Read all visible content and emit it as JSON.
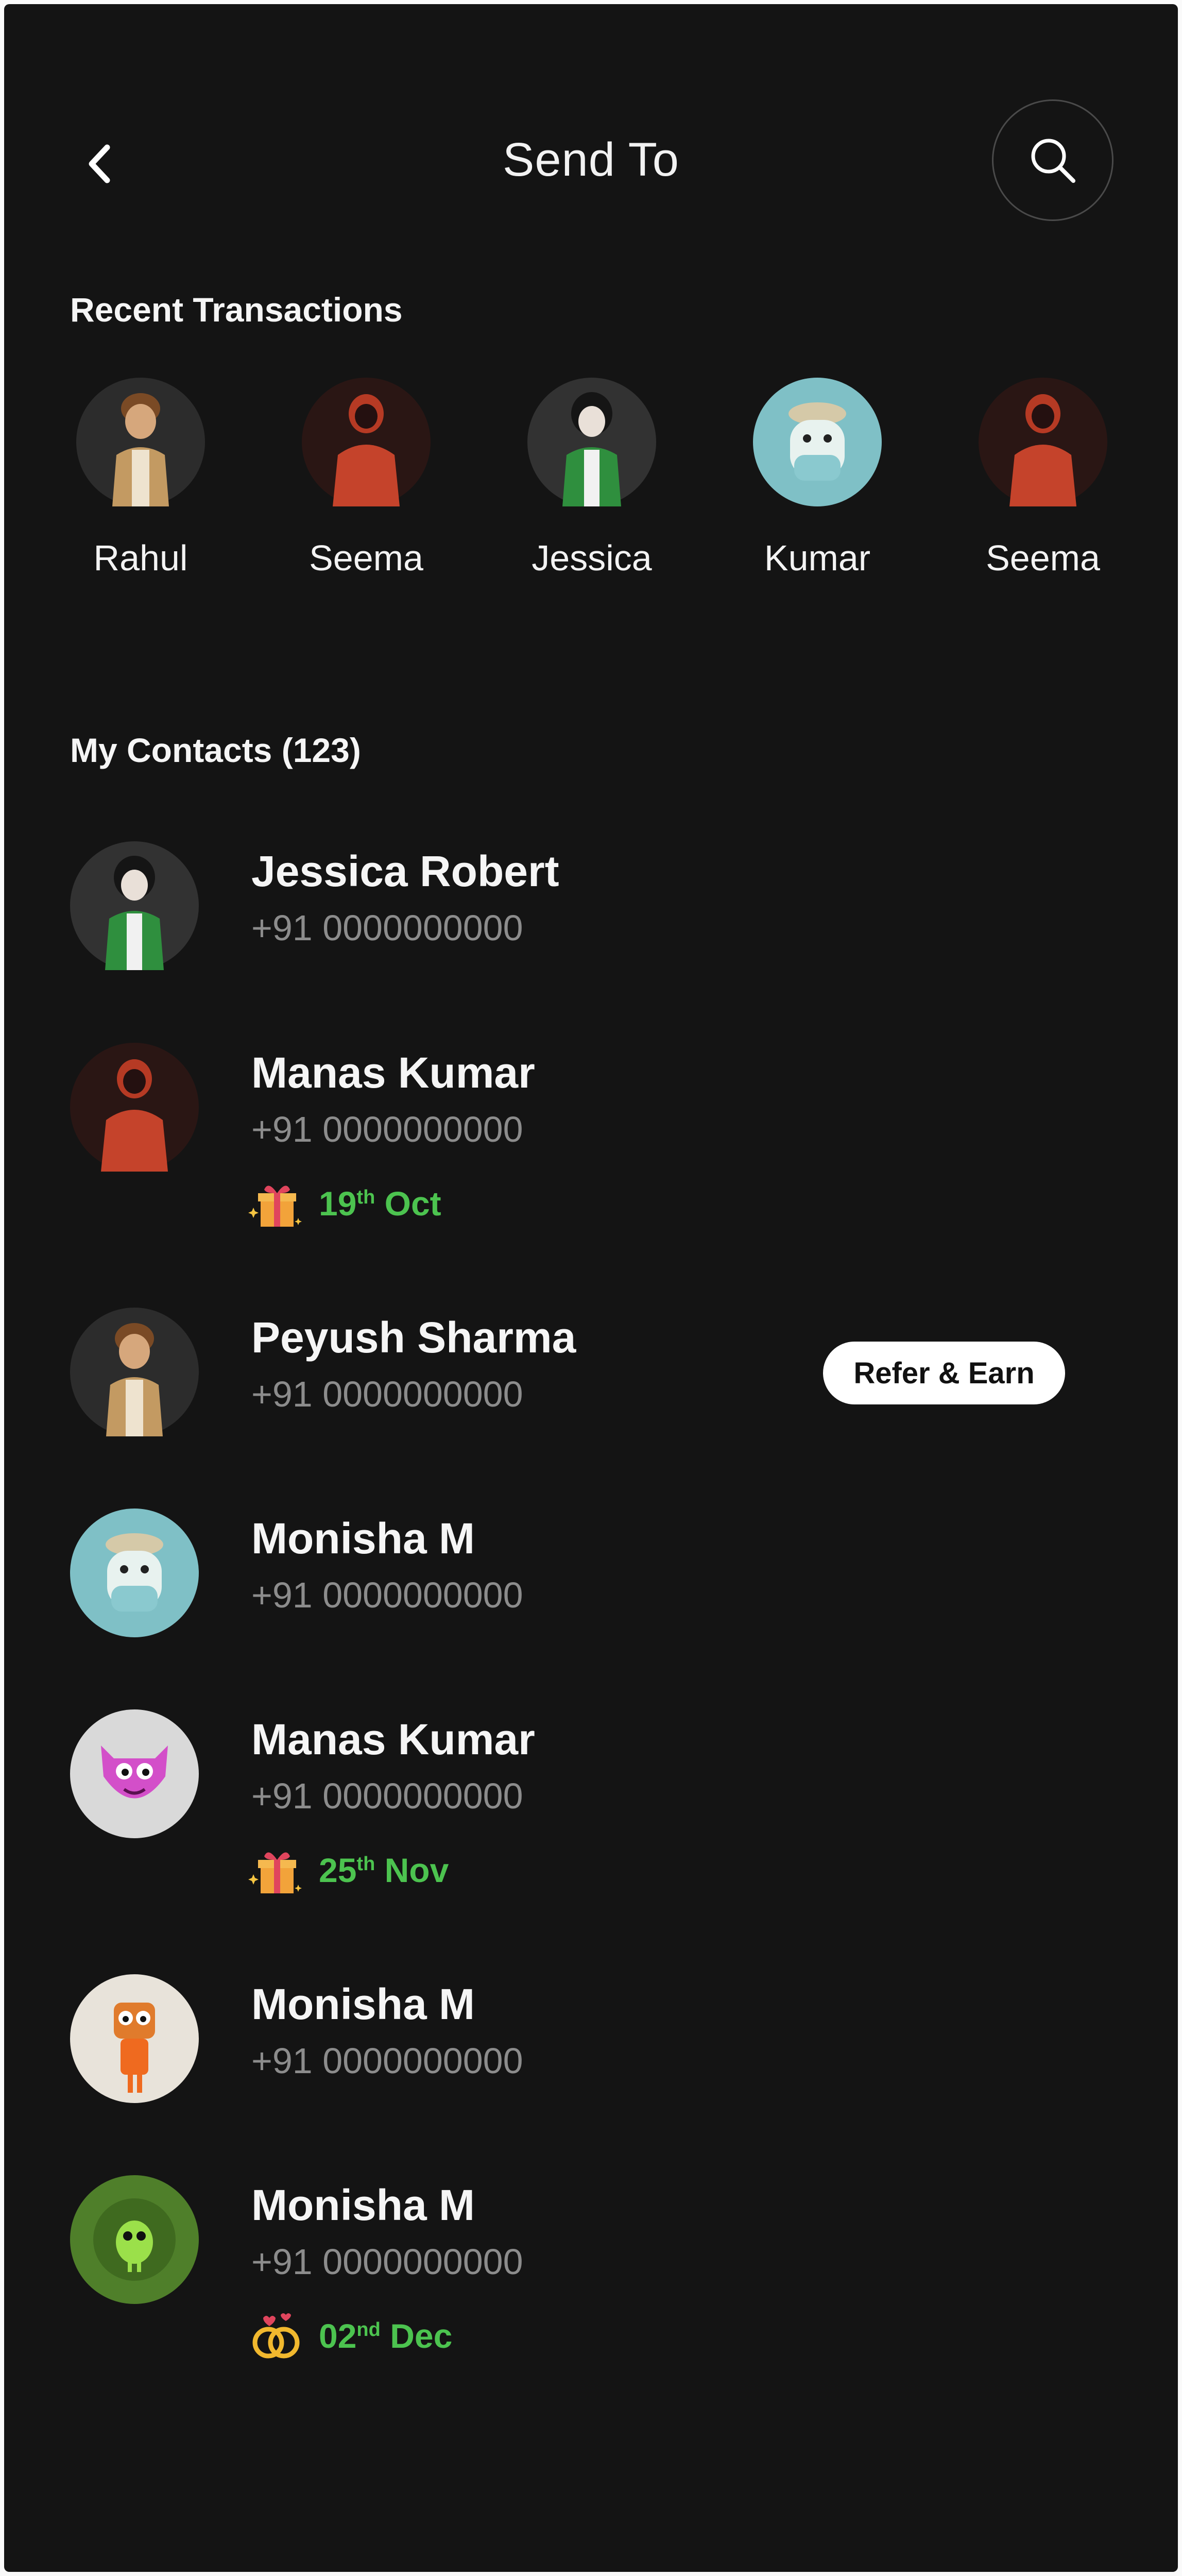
{
  "header": {
    "title": "Send To",
    "back_icon": "chevron-left-icon",
    "search_icon": "search-icon"
  },
  "recent": {
    "title": "Recent Transactions",
    "items": [
      {
        "name": "Rahul"
      },
      {
        "name": "Seema"
      },
      {
        "name": "Jessica"
      },
      {
        "name": "Kumar"
      },
      {
        "name": "Seema"
      }
    ]
  },
  "contacts": {
    "title": "My Contacts (123)",
    "items": [
      {
        "name": "Jessica Robert",
        "phone": "+91 0000000000"
      },
      {
        "name": "Manas Kumar",
        "phone": "+91 0000000000",
        "event": {
          "day": "19",
          "suffix": "th",
          "month": "Oct",
          "icon": "gift-icon"
        }
      },
      {
        "name": "Peyush Sharma",
        "phone": "+91 0000000000",
        "action": "Refer & Earn"
      },
      {
        "name": "Monisha M",
        "phone": "+91 0000000000"
      },
      {
        "name": "Manas Kumar",
        "phone": "+91 0000000000",
        "event": {
          "day": "25",
          "suffix": "th",
          "month": "Nov",
          "icon": "gift-icon"
        }
      },
      {
        "name": "Monisha M",
        "phone": "+91 0000000000"
      },
      {
        "name": "Monisha M",
        "phone": "+91 0000000000",
        "event": {
          "day": "02",
          "suffix": "nd",
          "month": "Dec",
          "icon": "rings-icon"
        }
      }
    ]
  },
  "colors": {
    "background": "#141414",
    "accent_green": "#4cc34f",
    "muted_text": "#8c8c8c"
  }
}
